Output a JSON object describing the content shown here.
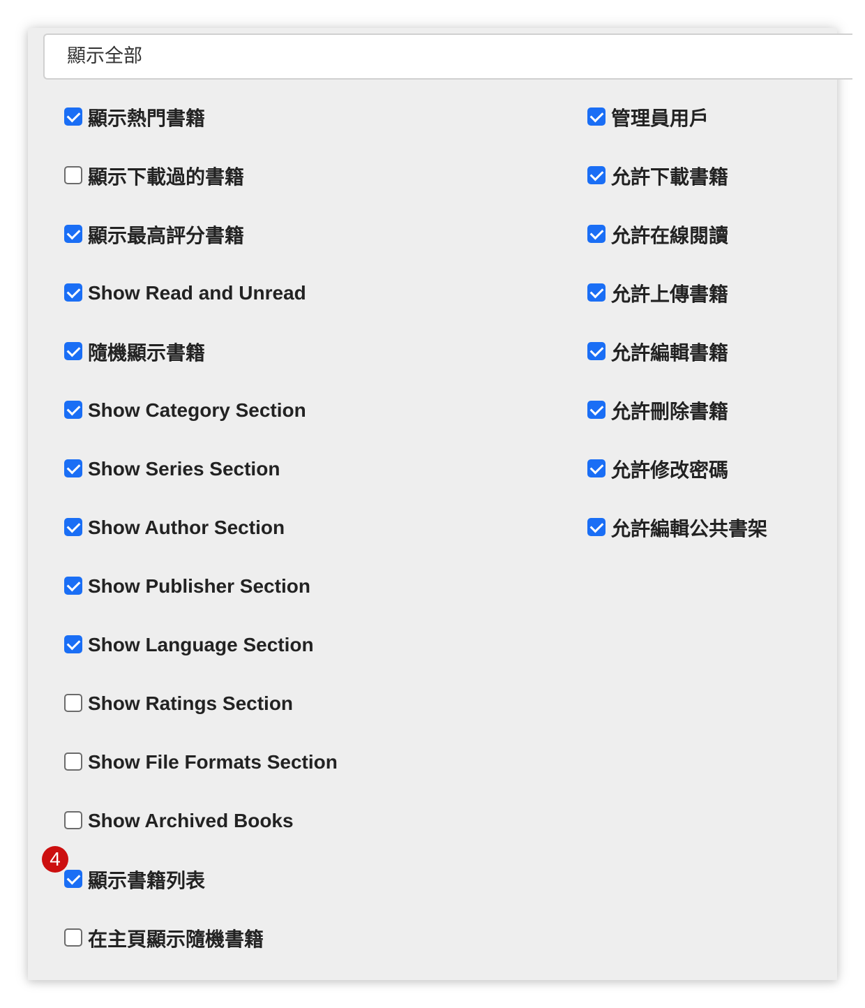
{
  "select": {
    "value": "顯示全部"
  },
  "left_options": [
    {
      "label": "顯示熱門書籍",
      "checked": true
    },
    {
      "label": "顯示下載過的書籍",
      "checked": false
    },
    {
      "label": "顯示最高評分書籍",
      "checked": true
    },
    {
      "label": "Show Read and Unread",
      "checked": true
    },
    {
      "label": "隨機顯示書籍",
      "checked": true
    },
    {
      "label": "Show Category Section",
      "checked": true
    },
    {
      "label": "Show Series Section",
      "checked": true
    },
    {
      "label": "Show Author Section",
      "checked": true
    },
    {
      "label": "Show Publisher Section",
      "checked": true
    },
    {
      "label": "Show Language Section",
      "checked": true
    },
    {
      "label": "Show Ratings Section",
      "checked": false
    },
    {
      "label": "Show File Formats Section",
      "checked": false
    },
    {
      "label": "Show Archived Books",
      "checked": false
    },
    {
      "label": "顯示書籍列表",
      "checked": true
    },
    {
      "label": "在主頁顯示隨機書籍",
      "checked": false
    }
  ],
  "right_options": [
    {
      "label": "管理員用戶",
      "checked": true
    },
    {
      "label": "允許下載書籍",
      "checked": true
    },
    {
      "label": "允許在線閱讀",
      "checked": true
    },
    {
      "label": "允許上傳書籍",
      "checked": true
    },
    {
      "label": "允許編輯書籍",
      "checked": true
    },
    {
      "label": "允許刪除書籍",
      "checked": true
    },
    {
      "label": "允許修改密碼",
      "checked": true
    },
    {
      "label": "允許編輯公共書架",
      "checked": true
    }
  ],
  "annotation": {
    "badge_number": "4"
  },
  "colors": {
    "checkbox_checked": "#1a6ef5",
    "badge": "#cc0f0f",
    "panel_background": "#eeeeee"
  }
}
